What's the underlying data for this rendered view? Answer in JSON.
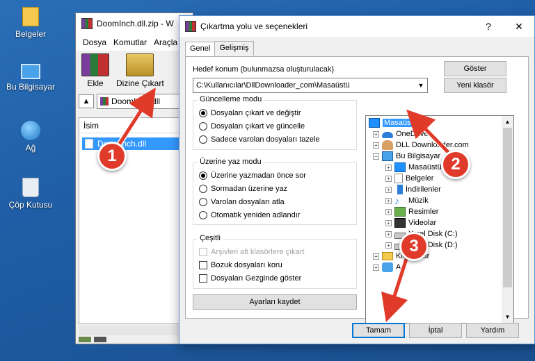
{
  "desktop": {
    "icons": [
      {
        "label": "Belgeler",
        "icon": "folder-documents-icon"
      },
      {
        "label": "Bu Bilgisayar",
        "icon": "computer-icon"
      },
      {
        "label": "Ağ",
        "icon": "network-globe-icon"
      },
      {
        "label": "Çöp Kutusu",
        "icon": "recycle-bin-icon"
      }
    ]
  },
  "winrar": {
    "title": "DoomInch.dll.zip - W",
    "menu": [
      "Dosya",
      "Komutlar",
      "Araçla"
    ],
    "tools": [
      {
        "label": "Ekle",
        "icon": "books-add-icon"
      },
      {
        "label": "Dizine Çıkart",
        "icon": "extract-folder-icon"
      }
    ],
    "address": "DoomInch.dll",
    "column_name": "İsim",
    "file": "DoomInch.dll"
  },
  "dialog": {
    "title": "Çıkartma yolu ve seçenekleri",
    "help_glyph": "?",
    "close_glyph": "✕",
    "tabs": [
      "Genel",
      "Gelişmiş"
    ],
    "dest_label": "Hedef konum (bulunmazsa oluşturulacak)",
    "dest_value": "C:\\Kullanıcılar\\DllDownloader_com\\Masaüstü",
    "show_button": "Göster",
    "new_folder_button": "Yeni klasör",
    "update_mode": {
      "title": "Güncelleme modu",
      "options": [
        "Dosyaları çıkart ve değiştir",
        "Dosyaları çıkart ve güncelle",
        "Sadece varolan dosyaları tazele"
      ]
    },
    "overwrite_mode": {
      "title": "Üzerine yaz modu",
      "options": [
        "Üzerine yazmadan önce sor",
        "Sormadan üzerine yaz",
        "Varolan dosyaları atla",
        "Otomatik yeniden adlandır"
      ]
    },
    "misc": {
      "title": "Çeşitli",
      "options": [
        "Arşivleri alt klasörlere çıkart",
        "Bozuk dosyaları koru",
        "Dosyaları Gezginde göster"
      ]
    },
    "save_settings": "Ayarları kaydet",
    "tree": [
      {
        "label": "Masaüstü",
        "icon": "desktop-icon"
      },
      {
        "label": "OneDrive",
        "icon": "onedrive-cloud-icon"
      },
      {
        "label": "DLL Downloader.com",
        "icon": "user-folder-icon"
      },
      {
        "label": "Bu Bilgisayar",
        "icon": "computer-icon"
      },
      {
        "label": "Masaüstü",
        "icon": "desktop-icon"
      },
      {
        "label": "Belgeler",
        "icon": "documents-icon"
      },
      {
        "label": "İndirilenler",
        "icon": "downloads-icon"
      },
      {
        "label": "Müzik",
        "icon": "music-icon"
      },
      {
        "label": "Resimler",
        "icon": "pictures-icon"
      },
      {
        "label": "Videolar",
        "icon": "videos-icon"
      },
      {
        "label": "Yerel Disk (C:)",
        "icon": "disk-icon"
      },
      {
        "label": "Yerel Disk (D:)",
        "icon": "disk-icon"
      },
      {
        "label": "Kitaplıklar",
        "icon": "libraries-folder-icon"
      },
      {
        "label": "Ağ",
        "icon": "network-icon"
      }
    ],
    "ok_button": "Tamam",
    "cancel_button": "İptal",
    "help_button": "Yardım"
  },
  "annotations": [
    {
      "number": "1"
    },
    {
      "number": "2"
    },
    {
      "number": "3"
    }
  ],
  "colors": {
    "badge": "#e03b2a",
    "selection": "#3399ff",
    "accent": "#0078d7"
  }
}
